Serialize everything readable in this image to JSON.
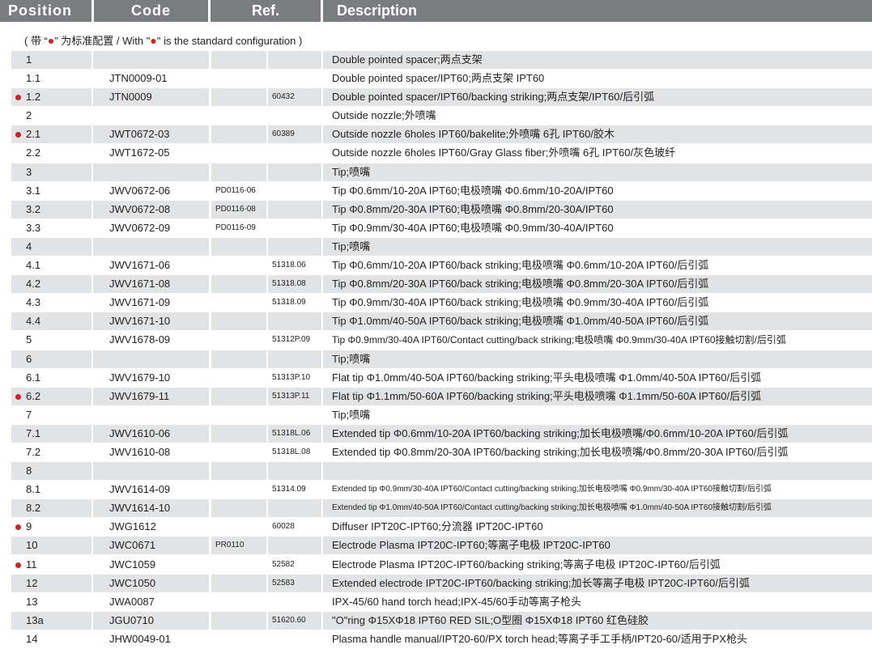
{
  "header": {
    "position": "Position",
    "code": "Code",
    "ref": "Ref.",
    "description": "Description"
  },
  "note": {
    "prefix": "( 带 “",
    "dot": "●",
    "middle": "” 为标准配置 / With \"",
    "suffix": "\" is the standard configuration )"
  },
  "colors": {
    "header_bg": "#7a7c80",
    "row_shade": "#e2e3e5",
    "marker": "#cc2229"
  },
  "rows": [
    {
      "pos": "1",
      "code": "",
      "pd": "",
      "ref": "",
      "desc": "Double pointed spacer;两点支架",
      "std": false,
      "shaded": true
    },
    {
      "pos": "1.1",
      "code": "JTN0009-01",
      "pd": "",
      "ref": "",
      "desc": "Double pointed spacer/IPT60;两点支架 IPT60",
      "std": false,
      "shaded": false
    },
    {
      "pos": "1.2",
      "code": "JTN0009",
      "pd": "",
      "ref": "60432",
      "desc": "Double pointed spacer/IPT60/backing striking;两点支架/IPT60/后引弧",
      "std": true,
      "shaded": true
    },
    {
      "pos": "2",
      "code": "",
      "pd": "",
      "ref": "",
      "desc": "Outside nozzle;外喷嘴",
      "std": false,
      "shaded": false
    },
    {
      "pos": "2.1",
      "code": "JWT0672-03",
      "pd": "",
      "ref": "60389",
      "desc": "Outside nozzle 6holes IPT60/bakelite;外喷嘴 6孔 IPT60/胶木",
      "std": true,
      "shaded": true
    },
    {
      "pos": "2.2",
      "code": "JWT1672-05",
      "pd": "",
      "ref": "",
      "desc": "Outside nozzle 6holes IPT60/Gray Glass fiber;外喷嘴 6孔 IPT60/灰色玻纤",
      "std": false,
      "shaded": false
    },
    {
      "pos": "3",
      "code": "",
      "pd": "",
      "ref": "",
      "desc": "Tip;喷嘴",
      "std": false,
      "shaded": true
    },
    {
      "pos": "3.1",
      "code": "JWV0672-06",
      "pd": "PD0116-06",
      "ref": "",
      "desc": "Tip Φ0.6mm/10-20A IPT60;电极喷嘴 Φ0.6mm/10-20A/IPT60",
      "std": false,
      "shaded": false
    },
    {
      "pos": "3.2",
      "code": "JWV0672-08",
      "pd": "PD0116-08",
      "ref": "",
      "desc": "Tip Φ0.8mm/20-30A IPT60;电极喷嘴 Φ0.8mm/20-30A/IPT60",
      "std": false,
      "shaded": true
    },
    {
      "pos": "3.3",
      "code": "JWV0672-09",
      "pd": "PD0116-09",
      "ref": "",
      "desc": "Tip Φ0.9mm/30-40A IPT60;电极喷嘴 Φ0.9mm/30-40A/IPT60",
      "std": false,
      "shaded": false
    },
    {
      "pos": "4",
      "code": "",
      "pd": "",
      "ref": "",
      "desc": "Tip;喷嘴",
      "std": false,
      "shaded": true
    },
    {
      "pos": "4.1",
      "code": "JWV1671-06",
      "pd": "",
      "ref": "51318.06",
      "desc": "Tip Φ0.6mm/10-20A IPT60/back striking;电极喷嘴 Φ0.6mm/10-20A IPT60/后引弧",
      "std": false,
      "shaded": false
    },
    {
      "pos": "4.2",
      "code": "JWV1671-08",
      "pd": "",
      "ref": "51318.08",
      "desc": "Tip Φ0.8mm/20-30A IPT60/back striking;电极喷嘴 Φ0.8mm/20-30A IPT60/后引弧",
      "std": false,
      "shaded": true
    },
    {
      "pos": "4.3",
      "code": "JWV1671-09",
      "pd": "",
      "ref": "51318.09",
      "desc": "Tip Φ0.9mm/30-40A IPT60/back striking;电极喷嘴 Φ0.9mm/30-40A IPT60/后引弧",
      "std": false,
      "shaded": false
    },
    {
      "pos": "4.4",
      "code": "JWV1671-10",
      "pd": "",
      "ref": "",
      "desc": "Tip Φ1.0mm/40-50A IPT60/back striking;电极喷嘴 Φ1.0mm/40-50A IPT60/后引弧",
      "std": false,
      "shaded": true
    },
    {
      "pos": "5",
      "code": "JWV1678-09",
      "pd": "",
      "ref": "51312P.09",
      "desc": "Tip Φ0.9mm/30-40A IPT60/Contact cutting/back striking;电极喷嘴 Φ0.9mm/30-40A IPT60接触切割/后引弧",
      "std": false,
      "shaded": false,
      "size": "mid"
    },
    {
      "pos": "6",
      "code": "",
      "pd": "",
      "ref": "",
      "desc": "Tip;喷嘴",
      "std": false,
      "shaded": true
    },
    {
      "pos": "6.1",
      "code": "JWV1679-10",
      "pd": "",
      "ref": "51313P.10",
      "desc": "Flat tip Φ1.0mm/40-50A IPT60/backing striking;平头电极喷嘴 Φ1.0mm/40-50A IPT60/后引弧",
      "std": false,
      "shaded": false
    },
    {
      "pos": "6.2",
      "code": "JWV1679-11",
      "pd": "",
      "ref": "51313P.11",
      "desc": "Flat tip Φ1.1mm/50-60A IPT60/backing striking;平头电极喷嘴 Φ1.1mm/50-60A IPT60/后引弧",
      "std": true,
      "shaded": true
    },
    {
      "pos": "7",
      "code": "",
      "pd": "",
      "ref": "",
      "desc": "Tip;喷嘴",
      "std": false,
      "shaded": false
    },
    {
      "pos": "7.1",
      "code": "JWV1610-06",
      "pd": "",
      "ref": "51318L.06",
      "desc": "Extended tip Φ0.6mm/10-20A IPT60/backing striking;加长电极喷嘴/Φ0.6mm/10-20A IPT60/后引弧",
      "std": false,
      "shaded": true
    },
    {
      "pos": "7.2",
      "code": "JWV1610-08",
      "pd": "",
      "ref": "51318L.08",
      "desc": "Extended tip Φ0.8mm/20-30A IPT60/backing striking;加长电极喷嘴/Φ0.8mm/20-30A IPT60/后引弧",
      "std": false,
      "shaded": false
    },
    {
      "pos": "8",
      "code": "",
      "pd": "",
      "ref": "",
      "desc": "",
      "std": false,
      "shaded": true
    },
    {
      "pos": "8.1",
      "code": "JWV1614-09",
      "pd": "",
      "ref": "51314.09",
      "desc": "Extended tip Φ0.9mm/30-40A IPT60/Contact cutting/backing striking;加长电极喷嘴 Φ0.9mm/30-40A IPT60接触切割/后引弧",
      "std": false,
      "shaded": false,
      "size": "small"
    },
    {
      "pos": "8.2",
      "code": "JWV1614-10",
      "pd": "",
      "ref": "",
      "desc": "Extended tip Φ1.0mm/40-50A IPT60/Contact cutting/backing striking;加长电极喷嘴 Φ1.0mm/40-50A IPT60接触切割/后引弧",
      "std": false,
      "shaded": true,
      "size": "small"
    },
    {
      "pos": "9",
      "code": "JWG1612",
      "pd": "",
      "ref": "60028",
      "desc": "Diffuser IPT20C-IPT60;分流器 IPT20C-IPT60",
      "std": true,
      "shaded": false
    },
    {
      "pos": "10",
      "code": "JWC0671",
      "pd": "PR0110",
      "ref": "",
      "desc": "Electrode Plasma IPT20C-IPT60;等离子电极 IPT20C-IPT60",
      "std": false,
      "shaded": true
    },
    {
      "pos": "11",
      "code": "JWC1059",
      "pd": "",
      "ref": "52582",
      "desc": "Electrode Plasma IPT20C-IPT60/backing striking;等离子电极 IPT20C-IPT60/后引弧",
      "std": true,
      "shaded": false
    },
    {
      "pos": "12",
      "code": "JWC1050",
      "pd": "",
      "ref": "52583",
      "desc": "Extended electrode IPT20C-IPT60/backing striking;加长等离子电极 IPT20C-IPT60/后引弧",
      "std": false,
      "shaded": true
    },
    {
      "pos": "13",
      "code": "JWA0087",
      "pd": "",
      "ref": "",
      "desc": "IPX-45/60 hand torch head;IPX-45/60手动等离子枪头",
      "std": false,
      "shaded": false
    },
    {
      "pos": "13a",
      "code": "JGU0710",
      "pd": "",
      "ref": "51620.60",
      "desc": "\"O\"ring Φ15XΦ18 IPT60 RED SIL;O型圈 Φ15XΦ18 IPT60 红色硅胶",
      "std": false,
      "shaded": true
    },
    {
      "pos": "14",
      "code": "JHW0049-01",
      "pd": "",
      "ref": "",
      "desc": "Plasma handle manual/IPT20-60/PX torch head;等离子手工手柄/IPT20-60/适用于PX枪头",
      "std": false,
      "shaded": false
    }
  ]
}
